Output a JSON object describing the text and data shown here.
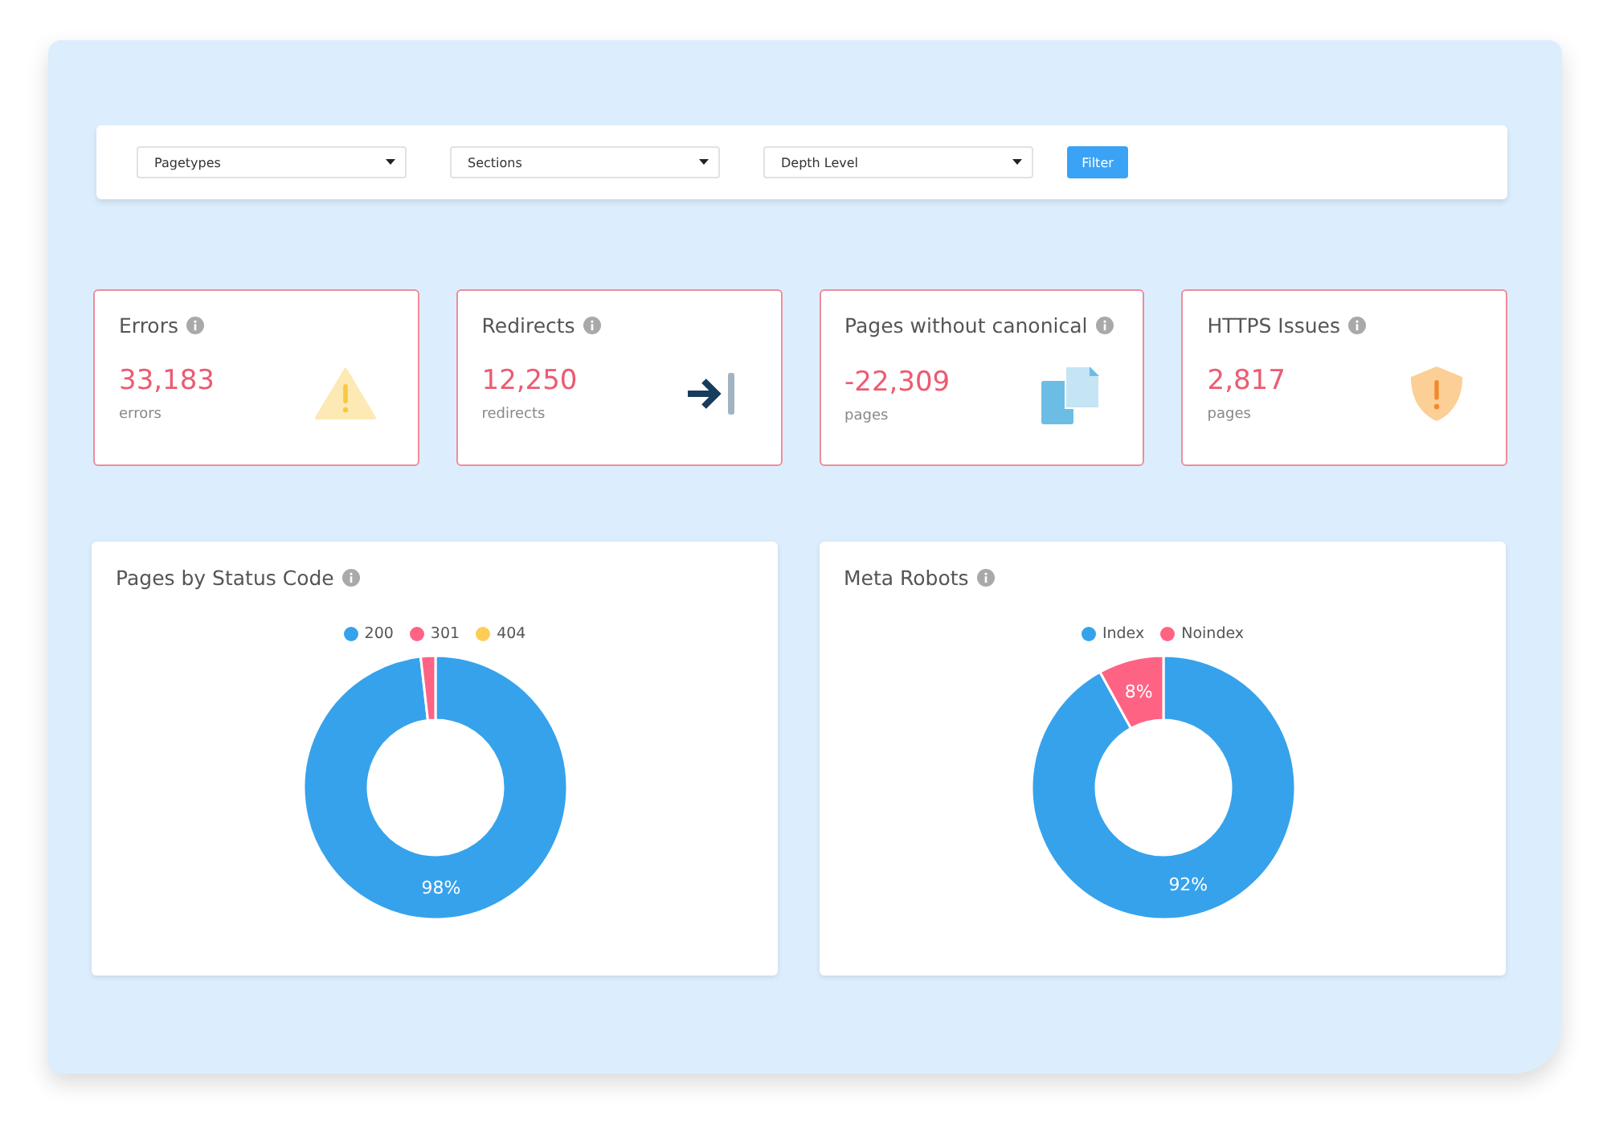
{
  "filters": {
    "selects": [
      {
        "label": "Pagetypes"
      },
      {
        "label": "Sections"
      },
      {
        "label": "Depth Level"
      }
    ],
    "button": "Filter"
  },
  "cards": [
    {
      "kind": "warning",
      "title": "Errors",
      "value": "33,183",
      "unit": "errors"
    },
    {
      "kind": "redirect",
      "title": "Redirects",
      "value": "12,250",
      "unit": "redirects"
    },
    {
      "kind": "copy",
      "title": "Pages without canonical",
      "value": "-22,309",
      "unit": "pages"
    },
    {
      "kind": "shield",
      "title": "HTTPS Issues",
      "value": "2,817",
      "unit": "pages"
    }
  ],
  "charts": [
    {
      "title": "Pages by Status Code",
      "chart_data": {
        "type": "donut",
        "legend": "top",
        "categories": [
          "200",
          "301",
          "404"
        ],
        "values": [
          98.2,
          1.8,
          0
        ],
        "colors": [
          "#36a2eb",
          "#ff6384",
          "#ffcd56"
        ],
        "value_labels": [
          "98%",
          null,
          null
        ]
      }
    },
    {
      "title": "Meta Robots",
      "chart_data": {
        "type": "donut",
        "legend": "top",
        "categories": [
          "Index",
          "Noindex"
        ],
        "values": [
          92,
          8
        ],
        "colors": [
          "#36a2eb",
          "#ff6384"
        ],
        "value_labels": [
          "92%",
          "8%"
        ]
      }
    }
  ]
}
